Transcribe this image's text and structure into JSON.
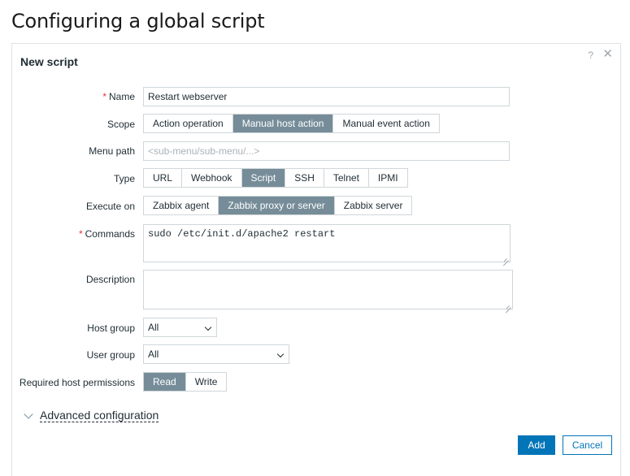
{
  "page": {
    "title": "Configuring a global script"
  },
  "dialog": {
    "title": "New script",
    "help_glyph": "?",
    "close_glyph": "✕",
    "fields": {
      "name": {
        "label": "Name",
        "required_mark": "*",
        "value": "Restart webserver"
      },
      "scope": {
        "label": "Scope",
        "options": [
          "Action operation",
          "Manual host action",
          "Manual event action"
        ],
        "selected": "Manual host action"
      },
      "menu_path": {
        "label": "Menu path",
        "value": "",
        "placeholder": "<sub-menu/sub-menu/...>"
      },
      "type": {
        "label": "Type",
        "options": [
          "URL",
          "Webhook",
          "Script",
          "SSH",
          "Telnet",
          "IPMI"
        ],
        "selected": "Script"
      },
      "execute_on": {
        "label": "Execute on",
        "options": [
          "Zabbix agent",
          "Zabbix proxy or server",
          "Zabbix server"
        ],
        "selected": "Zabbix proxy or server"
      },
      "commands": {
        "label": "Commands",
        "required_mark": "*",
        "value": "sudo /etc/init.d/apache2 restart"
      },
      "description": {
        "label": "Description",
        "value": ""
      },
      "host_group": {
        "label": "Host group",
        "value": "All"
      },
      "user_group": {
        "label": "User group",
        "value": "All"
      },
      "required_host_permissions": {
        "label": "Required host permissions",
        "options": [
          "Read",
          "Write"
        ],
        "selected": "Read"
      }
    },
    "advanced": {
      "label": "Advanced configuration"
    },
    "buttons": {
      "add": "Add",
      "cancel": "Cancel"
    }
  },
  "colors": {
    "accent": "#0275b8",
    "segment_active": "#768d99",
    "required": "#e33734"
  }
}
